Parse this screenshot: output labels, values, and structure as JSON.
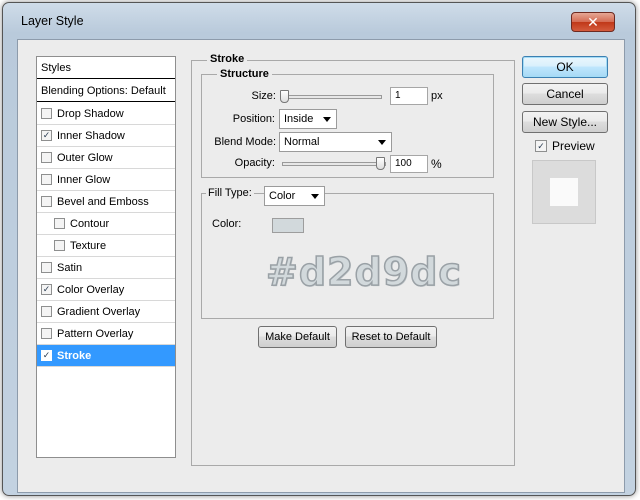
{
  "window": {
    "title": "Layer Style",
    "close_glyph": "✕"
  },
  "styles_panel": {
    "header": "Styles",
    "blending_options": "Blending Options: Default",
    "items": [
      {
        "label": "Drop Shadow",
        "checked": false,
        "indent": false,
        "selected": false
      },
      {
        "label": "Inner Shadow",
        "checked": true,
        "indent": false,
        "selected": false
      },
      {
        "label": "Outer Glow",
        "checked": false,
        "indent": false,
        "selected": false
      },
      {
        "label": "Inner Glow",
        "checked": false,
        "indent": false,
        "selected": false
      },
      {
        "label": "Bevel and Emboss",
        "checked": false,
        "indent": false,
        "selected": false
      },
      {
        "label": "Contour",
        "checked": false,
        "indent": true,
        "selected": false
      },
      {
        "label": "Texture",
        "checked": false,
        "indent": true,
        "selected": false
      },
      {
        "label": "Satin",
        "checked": false,
        "indent": false,
        "selected": false
      },
      {
        "label": "Color Overlay",
        "checked": true,
        "indent": false,
        "selected": false
      },
      {
        "label": "Gradient Overlay",
        "checked": false,
        "indent": false,
        "selected": false
      },
      {
        "label": "Pattern Overlay",
        "checked": false,
        "indent": false,
        "selected": false
      },
      {
        "label": "Stroke",
        "checked": true,
        "indent": false,
        "selected": true
      }
    ]
  },
  "stroke": {
    "group_title": "Stroke",
    "structure_title": "Structure",
    "size_label": "Size:",
    "size_value": "1",
    "size_unit": "px",
    "position_label": "Position:",
    "position_value": "Inside",
    "blend_label": "Blend Mode:",
    "blend_value": "Normal",
    "opacity_label": "Opacity:",
    "opacity_value": "100",
    "opacity_unit": "%",
    "size_slider_level": 0.0,
    "opacity_slider_level": 1.0,
    "fill_type_label": "Fill Type:",
    "fill_type_value": "Color",
    "color_label": "Color:",
    "color_hex_text": "#d2d9dc",
    "color": "#d2d9dc"
  },
  "buttons": {
    "make_default": "Make Default",
    "reset_default": "Reset to Default",
    "ok": "OK",
    "cancel": "Cancel",
    "new_style": "New Style..."
  },
  "preview": {
    "label": "Preview",
    "checked": true
  },
  "colors": {
    "selection": "#3399ff",
    "swatch": "#d2d9dc"
  }
}
